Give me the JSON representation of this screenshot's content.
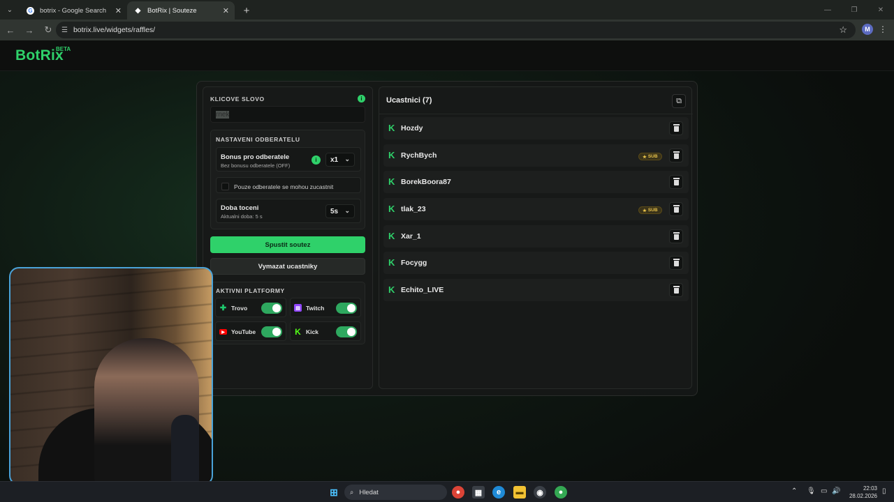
{
  "browser": {
    "tabs": [
      {
        "title": "botrix - Google Search",
        "active": false
      },
      {
        "title": "BotRix | Souteze",
        "active": true
      }
    ],
    "url": "botrix.live/widgets/raffles/",
    "profile_initial": "M"
  },
  "site": {
    "logo": "BotRix",
    "logo_badge": "BETA"
  },
  "raffle": {
    "keyword_label": "KLICOVE SLOVO",
    "keyword_value": "rnek",
    "subs_section_label": "NASTAVENI ODBERATELU",
    "bonus_title": "Bonus pro odberatele",
    "bonus_sub": "Bez bonusu odberatele (OFF)",
    "bonus_value": "x1",
    "only_subs_label": "Pouze odberatele se mohou zucastnit",
    "spin_title": "Doba toceni",
    "spin_sub": "Aktualni doba: 5 s",
    "spin_value": "5s",
    "start_button": "Spustit soutez",
    "clear_button": "Vymazat ucastniky",
    "platforms_label": "AKTIVNI PLATFORMY",
    "platforms": [
      {
        "name": "Trovo",
        "enabled": true,
        "icon": "trovo-icon",
        "color": "#1ecb6e"
      },
      {
        "name": "Twitch",
        "enabled": true,
        "icon": "twitch-icon",
        "color": "#9146ff"
      },
      {
        "name": "YouTube",
        "enabled": true,
        "icon": "youtube-icon",
        "color": "#ff0000"
      },
      {
        "name": "Kick",
        "enabled": true,
        "icon": "kick-icon",
        "color": "#53fc18"
      }
    ]
  },
  "participants": {
    "title": "Ucastnici (7)",
    "sub_badge": "SUB",
    "list": [
      {
        "name": "Hozdy",
        "sub": false
      },
      {
        "name": "RychBych",
        "sub": true
      },
      {
        "name": "BorekBoora87",
        "sub": false
      },
      {
        "name": "tlak_23",
        "sub": true
      },
      {
        "name": "Xar_1",
        "sub": false
      },
      {
        "name": "Focygg",
        "sub": false
      },
      {
        "name": "Echito_LIVE",
        "sub": false
      }
    ]
  },
  "taskbar": {
    "search_placeholder": "Hledat",
    "time": "22:03",
    "date": "28.02.2026"
  },
  "colors": {
    "accent": "#2fd16a",
    "sub_badge": "#e8c24a",
    "webcam_border": "#4aa3d9"
  }
}
